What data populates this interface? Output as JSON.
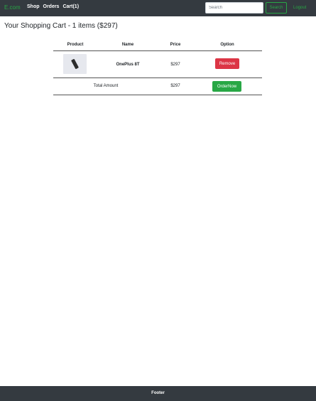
{
  "navbar": {
    "brand": "E.com",
    "links": [
      "Shop",
      "Orders",
      "Cart(1)"
    ],
    "search_placeholder": "Search",
    "search_button": "Search",
    "logout": "Logout",
    "accent_color": "#28a745",
    "background_color": "#343a40"
  },
  "cart": {
    "title": "Your Shopping Cart - 1 items ($297)",
    "columns": [
      "Product",
      "Name",
      "Price",
      "Option"
    ],
    "items": [
      {
        "product_icon": "phone-icon",
        "name": "OnePlus 8T",
        "price": "$297",
        "action": "Remove"
      }
    ],
    "total_label": "Total Amount",
    "total_value": "$297",
    "order_button": "OrderNow",
    "remove_color": "#dc3545"
  },
  "footer": {
    "text": "Footer"
  }
}
